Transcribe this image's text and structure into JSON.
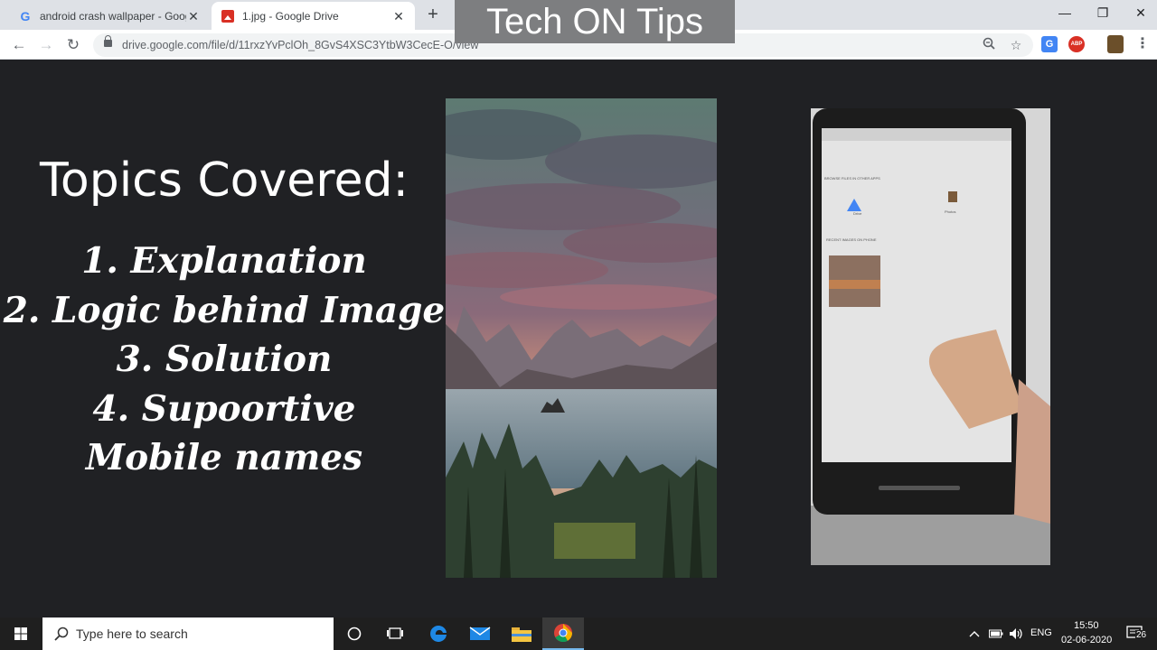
{
  "browser": {
    "tabs": [
      {
        "title": "android crash wallpaper - Google",
        "close": "✕"
      },
      {
        "title": "1.jpg - Google Drive",
        "close": "✕"
      }
    ],
    "new_tab": "+",
    "address_url": "drive.google.com/file/d/11rxzYvPclOh_8GvS4XSC3YtbW3CecE-O/view",
    "window_controls": {
      "minimize": "—",
      "maximize": "❐",
      "close": "✕"
    }
  },
  "watermark": "Tech ON Tips",
  "slide": {
    "heading": "Topics Covered:",
    "topics": [
      "1. Explanation",
      "2. Logic behind Image",
      "3. Solution",
      "4. Supoortive",
      "Mobile names"
    ]
  },
  "phone_screen": {
    "section_other_apps": "BROWSE FILES IN OTHER APPS",
    "drive_label": "Drive",
    "photos_label": "Photos",
    "section_recent": "RECENT IMAGES ON PHONE"
  },
  "taskbar": {
    "search_placeholder": "Type here to search",
    "language": "ENG",
    "time": "15:50",
    "date": "02-06-2020",
    "notification_count": "26"
  },
  "colors": {
    "watermark_bg": "#7d7e80",
    "content_bg": "#202124",
    "tabstrip_bg": "#dee1e6",
    "taskbar_bg": "#1f1f1f"
  }
}
